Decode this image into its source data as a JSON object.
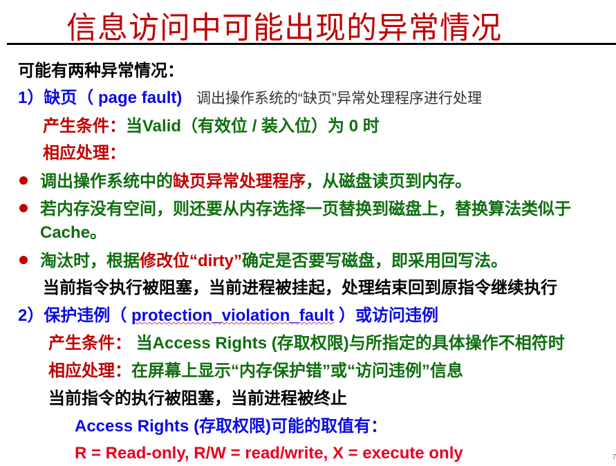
{
  "title": "信息访问中可能出现的异常情况",
  "intro": "可能有两种异常情况：",
  "fault1": {
    "heading": "1）缺页（ page fault)",
    "note": "调出操作系统的“缺页”异常处理程序进行处理",
    "cond_label": "产生条件：",
    "cond_text": "当Valid（有效位 / 装入位）为 0 时",
    "handle_label": "相应处理：",
    "bullets": [
      {
        "a": "调出操作系统中的",
        "b": "缺页异常处理程序",
        "c": "，从磁盘读页到内存。"
      },
      {
        "a": "若内存没有空间，则还要从内存选择一页替换到磁盘上，替换算法类似于",
        "c": "Cache。"
      },
      {
        "a": "淘汰时，根据",
        "b": "修改位“dirty”",
        "c": "确定是否要写磁盘，即采用回写法。"
      }
    ],
    "result": "当前指令执行被阻塞，当前进程被挂起，处理结束回到原指令继续执行"
  },
  "fault2": {
    "prefix": "2）保护违例（ ",
    "term": "protection_violation_fault",
    "suffix": " ）或访问违例",
    "cond_label": "产生条件：",
    "cond_text": "当Access Rights (存取权限)与所指定的具体操作不相符时",
    "handle_label": "相应处理：",
    "handle_text": "在屏幕上显示“内存保护错”或“访问违例”信息",
    "result": "当前指令的执行被阻塞，当前进程被终止",
    "rights_heading": "Access Rights (存取权限)可能的取值有：",
    "rights_values": "R = Read-only,  R/W = read/write,  X = execute only"
  },
  "page_number": "7"
}
